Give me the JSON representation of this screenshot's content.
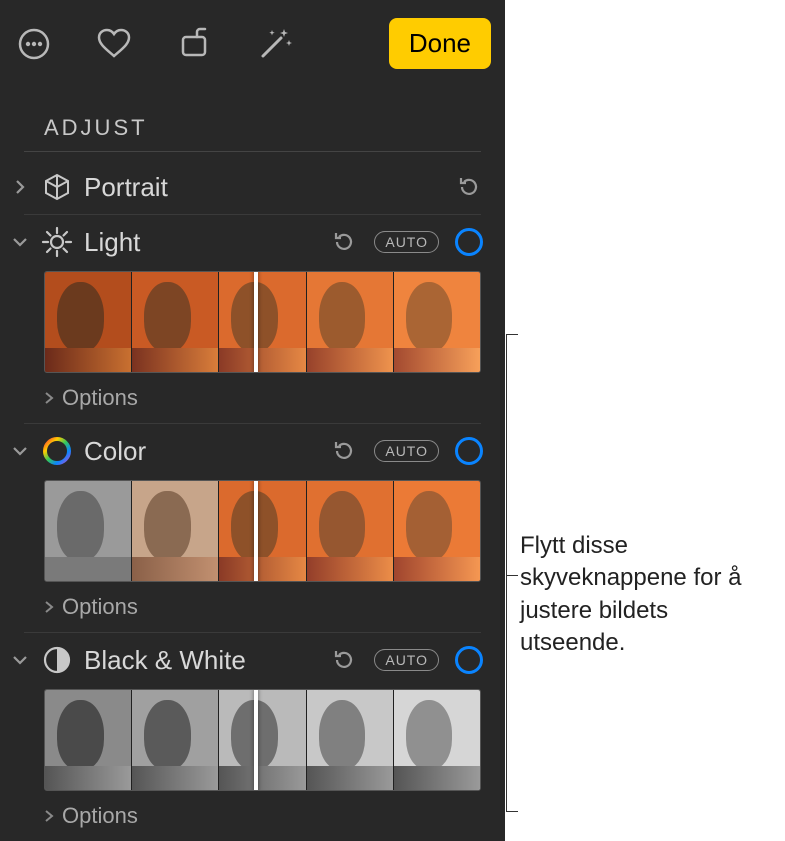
{
  "toolbar": {
    "done_label": "Done"
  },
  "section_title": "ADJUST",
  "portrait": {
    "label": "Portrait"
  },
  "light": {
    "label": "Light",
    "auto_label": "AUTO",
    "options_label": "Options"
  },
  "color": {
    "label": "Color",
    "auto_label": "AUTO",
    "options_label": "Options"
  },
  "bw": {
    "label": "Black & White",
    "auto_label": "AUTO",
    "options_label": "Options"
  },
  "callout": {
    "text": "Flytt disse skyveknappene for å justere bildets utseende."
  }
}
